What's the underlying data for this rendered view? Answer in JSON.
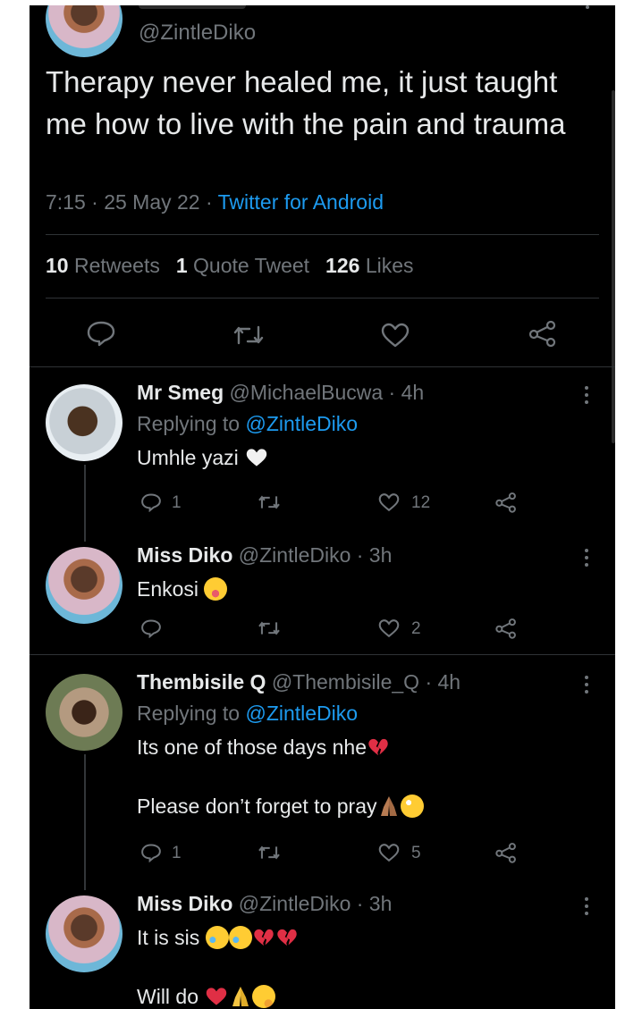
{
  "main_tweet": {
    "handle": "@ZintleDiko",
    "text": "Therapy never healed me, it just taught me how to live with the pain and trauma",
    "time": "7:15 · 25 May 22 · ",
    "source": "Twitter for Android",
    "retweets_count": "10",
    "retweets_label": "Retweets",
    "quotes_count": "1",
    "quotes_label": "Quote Tweet",
    "likes_count": "126",
    "likes_label": "Likes"
  },
  "replies": [
    {
      "name": "Mr Smeg",
      "handle_time": " @MichaelBucwa · 4h",
      "replying_prefix": "Replying to ",
      "replying_to": "@ZintleDiko",
      "text": "Umhle yazi",
      "emoji": [
        "white-heart"
      ],
      "reply_count": "1",
      "like_count": "12"
    },
    {
      "name": "Miss Diko",
      "handle_time": " @ZintleDiko · 3h",
      "text": "Enkosi",
      "emoji": [
        "smiling-face"
      ],
      "reply_count": "",
      "like_count": "2"
    },
    {
      "name": "Thembisile Q",
      "handle_time": " @Thembisile_Q · 4h",
      "replying_prefix": "Replying to ",
      "replying_to": "@ZintleDiko",
      "text": "Its one of those days nhe",
      "text2": "Please don’t forget to pray",
      "emoji": [
        "broken-heart",
        "folded-hands",
        "rolling-eyes"
      ],
      "reply_count": "1",
      "like_count": "5"
    },
    {
      "name": "Miss Diko",
      "handle_time": " @ZintleDiko · 3h",
      "text": "It is sis",
      "text2": "Will do",
      "emoji": [
        "crying-face",
        "crying-face",
        "broken-heart",
        "broken-heart",
        "red-heart",
        "folded-hands",
        "hugging-face"
      ]
    }
  ],
  "colors": {
    "background": "#000000",
    "text": "#e7e9ea",
    "secondary": "#71767b",
    "link": "#1d9bf0",
    "divider": "#2f3336"
  }
}
